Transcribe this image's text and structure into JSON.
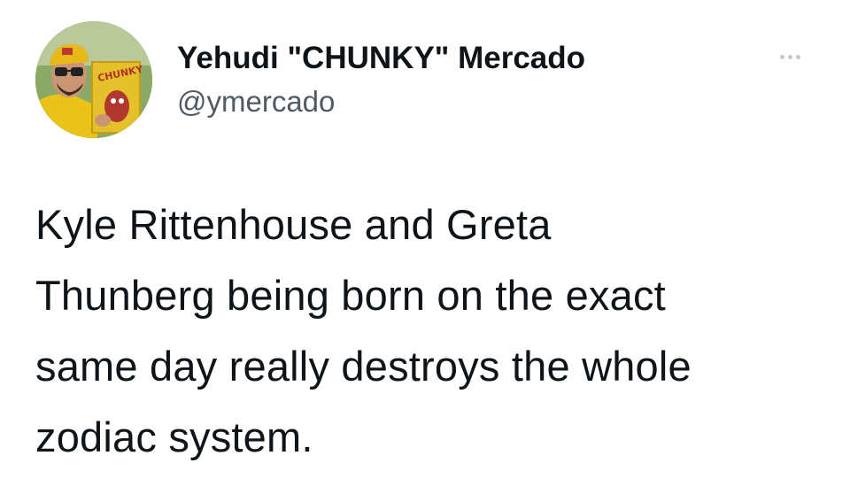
{
  "tweet": {
    "author": {
      "display_name": "Yehudi \"CHUNKY\" Mercado",
      "handle": "@ymercado",
      "avatar_icon": "profile-photo"
    },
    "more_icon": "more-options-icon",
    "text_lines": [
      "Kyle Rittenhouse and Greta",
      "Thunberg being born on the exact",
      "same day really destroys the whole",
      "zodiac system."
    ]
  },
  "colors": {
    "text": "#0f1419",
    "handle": "#4f5a63",
    "dots": "#c4c9cd",
    "background": "#ffffff"
  }
}
